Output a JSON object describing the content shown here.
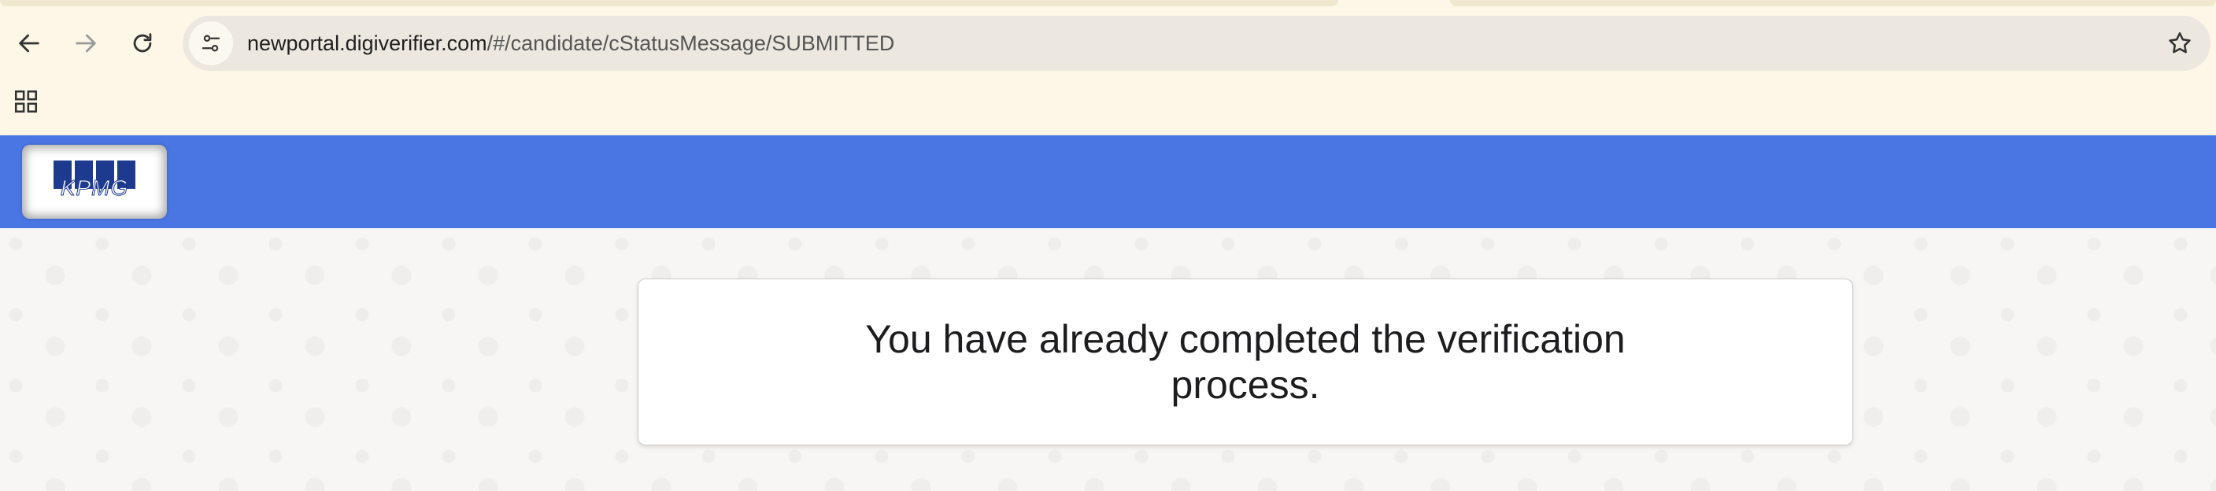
{
  "browser": {
    "url_host": "newportal.digiverifier.com",
    "url_path": "/#/candidate/cStatusMessage/SUBMITTED",
    "back_icon": "arrow-left-icon",
    "forward_icon": "arrow-right-icon",
    "reload_icon": "reload-icon",
    "site_info_icon": "tune-icon",
    "bookmark_icon": "star-outline-icon",
    "apps_icon": "grid-icon"
  },
  "header": {
    "logo_text": "KPMG",
    "background_color": "#4a76e3",
    "logo_color": "#1e3a8f"
  },
  "main": {
    "message": "You have already completed the verification process."
  }
}
